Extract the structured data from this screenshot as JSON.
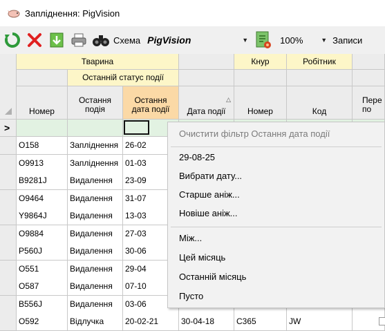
{
  "window": {
    "title": "Запліднення: PigVision"
  },
  "toolbar": {
    "scheme_label": "Схема",
    "scheme_value": "PigVision",
    "zoom_value": "100%",
    "records_label": "Записи"
  },
  "grid": {
    "group_headers": {
      "animal": "Тварина",
      "boar": "Кнур",
      "worker": "Робітник"
    },
    "subgroup_last_status": "Останній статус події",
    "columns": {
      "number": "Номер",
      "last_event_1": "Остання",
      "last_event_2": "подія",
      "last_event_date_1": "Остання",
      "last_event_date_2": "дата події",
      "event_date": "Дата події",
      "boar_number": "Номер",
      "worker_code": "Код",
      "extra_1": "Пере",
      "extra_2": "по"
    },
    "current_row_marker": ">",
    "rows": [
      {
        "number": "O158",
        "last_event": "Запліднення",
        "last_date": "26-02"
      },
      {
        "number": "O9913",
        "last_event": "Запліднення",
        "last_date": "01-03"
      },
      {
        "number": "B9281J",
        "last_event": "Видалення",
        "last_date": "23-09"
      },
      {
        "number": "O9464",
        "last_event": "Видалення",
        "last_date": "31-07"
      },
      {
        "number": "Y9864J",
        "last_event": "Видалення",
        "last_date": "13-03"
      },
      {
        "number": "O9884",
        "last_event": "Видалення",
        "last_date": "27-03"
      },
      {
        "number": "P560J",
        "last_event": "Видалення",
        "last_date": "30-06"
      },
      {
        "number": "O551",
        "last_event": "Видалення",
        "last_date": "29-04"
      },
      {
        "number": "O587",
        "last_event": "Видалення",
        "last_date": "07-10"
      },
      {
        "number": "B556J",
        "last_event": "Видалення",
        "last_date": "03-06"
      },
      {
        "number": "O592",
        "last_event": "Відлучка",
        "last_date": "20-02-21",
        "event_date": "30-04-18",
        "boar": "C365",
        "worker": "JW"
      }
    ]
  },
  "context_menu": {
    "items": [
      {
        "label": "Очистити фільтр Остання дата події",
        "disabled": true
      },
      {
        "label": "29-08-25"
      },
      {
        "label": "Вибрати дату..."
      },
      {
        "label": "Старше аніж..."
      },
      {
        "label": "Новіше аніж..."
      },
      {
        "label": "Між..."
      },
      {
        "label": "Цей місяць"
      },
      {
        "label": "Останній місяць"
      },
      {
        "label": "Пусто"
      }
    ]
  },
  "colors": {
    "group_header": "#fdf6c8",
    "selected_column_header": "#fbd9a6",
    "filter_row": "#e2f2e2",
    "menu_background": "#f2f2f2"
  },
  "icons": [
    "pig-app-icon",
    "refresh-icon",
    "delete-icon",
    "export-icon",
    "print-icon",
    "binoculars-icon",
    "scheme-settings-icon"
  ]
}
